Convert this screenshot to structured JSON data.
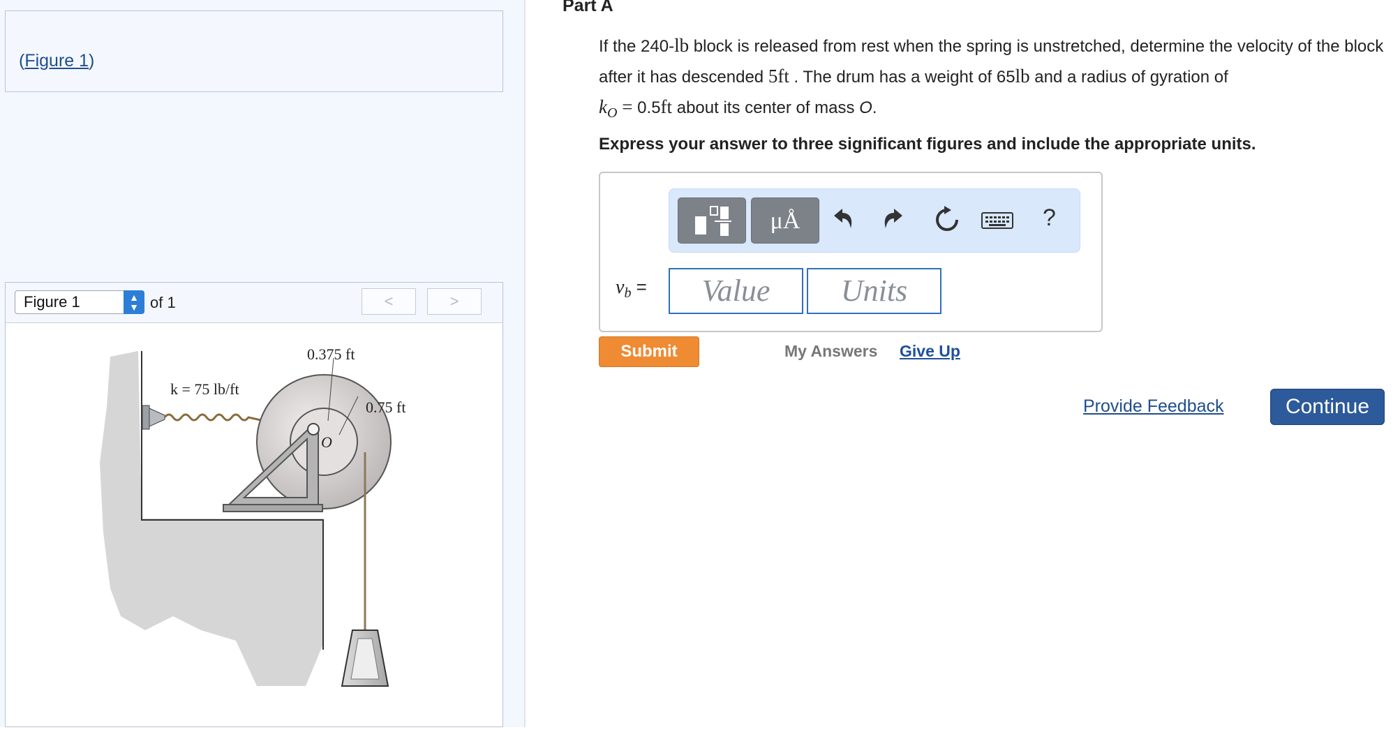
{
  "figure_link": {
    "open_paren": "(",
    "link_text": "Figure 1",
    "close_paren": ")"
  },
  "figure_nav": {
    "select_value": "Figure 1",
    "of_text": "of 1",
    "prev_glyph": "<",
    "next_glyph": ">"
  },
  "figure": {
    "spring_label": "k = 75 lb/ft",
    "inner_radius_label": "0.375 ft",
    "outer_radius_label": "0.75 ft",
    "center_label": "O"
  },
  "part": {
    "title": "Part A"
  },
  "problem": {
    "t1": "If the 240-",
    "u1": "lb",
    "t2": " block is released from rest when the spring is unstretched, determine the velocity of the block after it has descended ",
    "u2": "5ft",
    "t3": " . The drum has a weight of 65",
    "u3": "lb",
    "t4": " and a radius of gyration of ",
    "k_sym": "k",
    "k_sub": "O",
    "eq": " = ",
    "t5": "0.5",
    "u5": "ft",
    "t6": " about its center of mass ",
    "o_sym": "O",
    "t7": "."
  },
  "instruction": "Express your answer to three significant figures and include the appropriate units.",
  "toolbar": {
    "mu_label": "μÅ",
    "help_label": "?"
  },
  "answer": {
    "var": "v",
    "var_sub": "b",
    "equals": " =",
    "value_placeholder": "Value",
    "units_placeholder": "Units"
  },
  "actions": {
    "submit": "Submit",
    "my_answers": "My Answers",
    "give_up": "Give Up",
    "provide_feedback": "Provide Feedback",
    "continue": "Continue"
  },
  "colors": {
    "accent": "#2c5a9a",
    "submit": "#ef8b33",
    "link": "#1f4e8c",
    "toolbar_bg": "#d9e8fb"
  }
}
